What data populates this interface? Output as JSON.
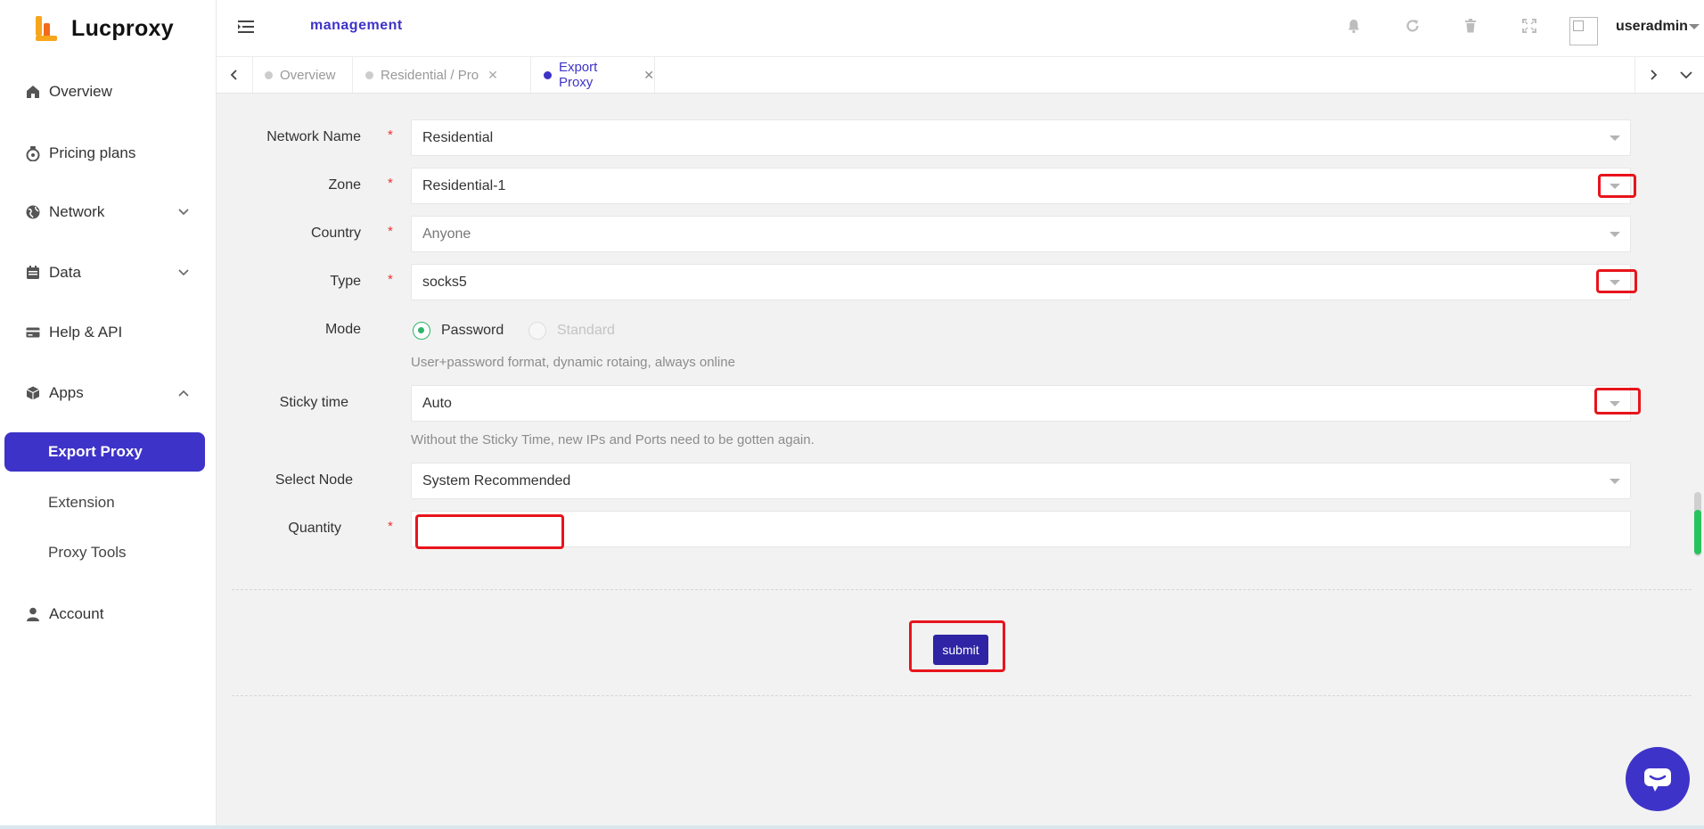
{
  "app": {
    "brand": "Lucproxy",
    "breadcrumb": "management",
    "username": "useradmin"
  },
  "sidebar": {
    "items": [
      {
        "label": "Overview",
        "icon": "home-icon"
      },
      {
        "label": "Pricing plans",
        "icon": "money-bag-icon"
      },
      {
        "label": "Network",
        "icon": "globe-icon",
        "expandable": true,
        "expanded": false
      },
      {
        "label": "Data",
        "icon": "calendar-icon",
        "expandable": true,
        "expanded": false
      },
      {
        "label": "Help & API",
        "icon": "card-icon"
      },
      {
        "label": "Apps",
        "icon": "cube-icon",
        "expandable": true,
        "expanded": true
      },
      {
        "label": "Account",
        "icon": "user-icon"
      }
    ],
    "apps_sub": [
      {
        "label": "Export Proxy",
        "active": true
      },
      {
        "label": "Extension",
        "active": false
      },
      {
        "label": "Proxy Tools",
        "active": false
      }
    ]
  },
  "header_icons": [
    "bell-icon",
    "refresh-icon",
    "trash-icon",
    "fullscreen-icon"
  ],
  "tabs": [
    {
      "label": "Overview",
      "closable": false,
      "active": false
    },
    {
      "label": "Residential / Pro",
      "closable": true,
      "active": false
    },
    {
      "label": "Export Proxy",
      "closable": true,
      "active": true
    }
  ],
  "form": {
    "network_name": {
      "label": "Network Name",
      "required": true,
      "value": "Residential"
    },
    "zone": {
      "label": "Zone",
      "required": true,
      "value": "Residential-1"
    },
    "country": {
      "label": "Country",
      "required": true,
      "value": "Anyone"
    },
    "type": {
      "label": "Type",
      "required": true,
      "value": "socks5"
    },
    "mode": {
      "label": "Mode",
      "options": [
        {
          "label": "Password",
          "selected": true,
          "disabled": false
        },
        {
          "label": "Standard",
          "selected": false,
          "disabled": true
        }
      ],
      "hint": "User+password format, dynamic rotaing, always online"
    },
    "sticky_time": {
      "label": "Sticky time",
      "value": "Auto",
      "hint": "Without the Sticky Time, new IPs and Ports need to be gotten again."
    },
    "select_node": {
      "label": "Select Node",
      "value": "System Recommended"
    },
    "quantity": {
      "label": "Quantity",
      "required": true,
      "value": ""
    },
    "required_mark": "*",
    "submit_label": "submit"
  },
  "colors": {
    "accent": "#3e33c8",
    "submit": "#2e24a4",
    "radio_on": "#2db56b",
    "required": "#e33333",
    "highlight": "#e8141c"
  }
}
